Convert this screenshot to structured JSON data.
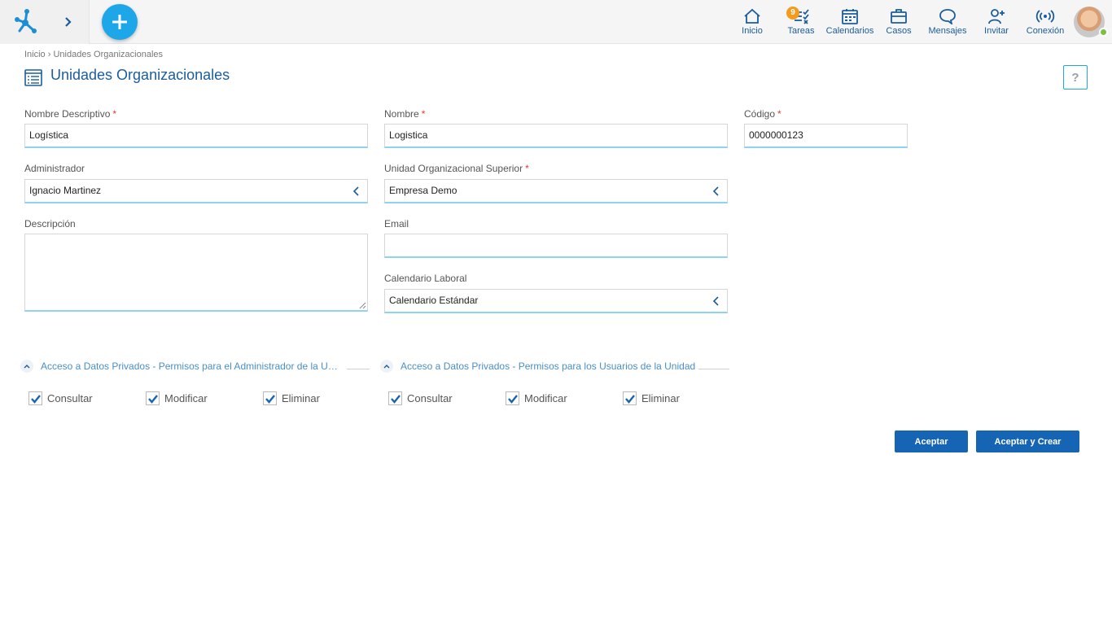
{
  "topbar": {
    "badge_count": "9",
    "nav": [
      {
        "id": "inicio",
        "label": "Inicio",
        "icon": "home-icon"
      },
      {
        "id": "tareas",
        "label": "Tareas",
        "icon": "tasks-icon"
      },
      {
        "id": "calendarios",
        "label": "Calendarios",
        "icon": "calendar-icon"
      },
      {
        "id": "casos",
        "label": "Casos",
        "icon": "briefcase-icon"
      },
      {
        "id": "mensajes",
        "label": "Mensajes",
        "icon": "chat-icon"
      },
      {
        "id": "invitar",
        "label": "Invitar",
        "icon": "invite-user-icon"
      },
      {
        "id": "conexion",
        "label": "Conexión",
        "icon": "connection-icon"
      }
    ],
    "accent_color": "#1ea7e8"
  },
  "breadcrumb": {
    "home": "Inicio",
    "separator": "›",
    "current": "Unidades Organizacionales"
  },
  "page": {
    "title": "Unidades Organizacionales",
    "help": "?"
  },
  "form": {
    "nombre_descriptivo": {
      "label": "Nombre Descriptivo",
      "value": "Logística",
      "required": "*"
    },
    "nombre": {
      "label": "Nombre",
      "value": "Logistica",
      "required": "*"
    },
    "codigo": {
      "label": "Código",
      "value": "0000000123",
      "required": "*"
    },
    "administrador": {
      "label": "Administrador",
      "value": "Ignacio Martinez"
    },
    "unidad_superior": {
      "label": "Unidad Organizacional Superior",
      "value": "Empresa Demo",
      "required": "*"
    },
    "descripcion": {
      "label": "Descripción",
      "value": ""
    },
    "email": {
      "label": "Email",
      "value": ""
    },
    "calendario": {
      "label": "Calendario Laboral",
      "value": "Calendario Estándar"
    }
  },
  "sections": {
    "admin": {
      "title": "Acceso a Datos Privados - Permisos para el Administrador de la Unidad",
      "options": [
        {
          "label": "Consultar",
          "checked": true
        },
        {
          "label": "Modificar",
          "checked": true
        },
        {
          "label": "Eliminar",
          "checked": true
        }
      ]
    },
    "users": {
      "title": "Acceso a Datos Privados - Permisos para los Usuarios de la Unidad",
      "options": [
        {
          "label": "Consultar",
          "checked": true
        },
        {
          "label": "Modificar",
          "checked": true
        },
        {
          "label": "Eliminar",
          "checked": true
        }
      ]
    }
  },
  "actions": {
    "accept": "Aceptar",
    "accept_create": "Aceptar y Crear"
  }
}
